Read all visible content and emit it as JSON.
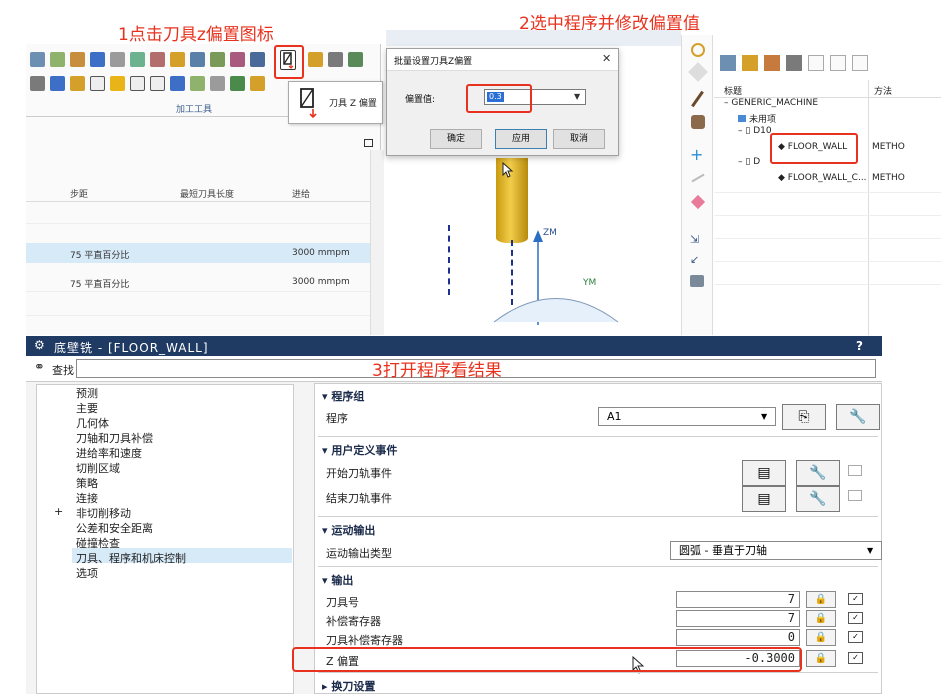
{
  "annotations": {
    "step1": "1点击刀具z偏置图标",
    "step2": "2选中程序并修改偏置值",
    "step3": "3打开程序看结果"
  },
  "toolbar": {
    "group_label": "加工工具",
    "tooltip": "刀具 Z 偏置"
  },
  "operation_grid": {
    "columns": [
      "步距",
      "最短刀具长度",
      "进给"
    ],
    "rows": [
      {
        "stepover": "75 平直百分比",
        "min_tool_length": "",
        "feed": "3000 mmpm"
      },
      {
        "stepover": "75 平直百分比",
        "min_tool_length": "",
        "feed": "3000 mmpm"
      }
    ]
  },
  "batch_dialog": {
    "title": "批量设置刀具Z偏置",
    "offset_label": "偏置值:",
    "offset_value": "0.3",
    "ok_label": "确定",
    "apply_label": "应用",
    "cancel_label": "取消",
    "close_glyph": "✕"
  },
  "viewport": {
    "axis_z": "ZM",
    "axis_y": "YM"
  },
  "navigator": {
    "col_name": "标题",
    "col_method": "方法",
    "items": {
      "root": "GENERIC_MACHINE",
      "unused": "未用项",
      "d10": "D10",
      "floor_wall": "FLOOR_WALL",
      "d_other": "D",
      "floor_wall_copy": "FLOOR_WALL_C...",
      "method1": "METHO",
      "method2": "METHO"
    }
  },
  "floor_wall_dialog": {
    "title": "底壁铣 - [FLOOR_WALL]",
    "help": "?",
    "search_label": "查找",
    "nav_items": [
      "预测",
      "主要",
      "几何体",
      "刀轴和刀具补偿",
      "进给率和速度",
      "切削区域",
      "策略",
      "连接",
      "非切削移动",
      "公差和安全距离",
      "碰撞检查",
      "刀具、程序和机床控制",
      "选项"
    ],
    "sections": {
      "program_group": "程序组",
      "user_events": "用户定义事件",
      "motion_output": "运动输出",
      "output": "输出",
      "tool_change": "换刀设置"
    },
    "program_label": "程序",
    "program_value": "A1",
    "start_event": "开始刀轨事件",
    "end_event": "结束刀轨事件",
    "motion_type_label": "运动输出类型",
    "motion_type_value": "圆弧 - 垂直于刀轴",
    "tool_number_label": "刀具号",
    "tool_number_value": "7",
    "comp_register_label": "补偿寄存器",
    "comp_register_value": "7",
    "tool_comp_register_label": "刀具补偿寄存器",
    "tool_comp_register_value": "0",
    "z_offset_label": "Z 偏置",
    "z_offset_value": "-0.3000"
  },
  "colors": {
    "accent": "#e8321e",
    "dialog_header": "#1f3a63",
    "tool_body": "#e8b418",
    "selection": "#d7eaf8"
  }
}
